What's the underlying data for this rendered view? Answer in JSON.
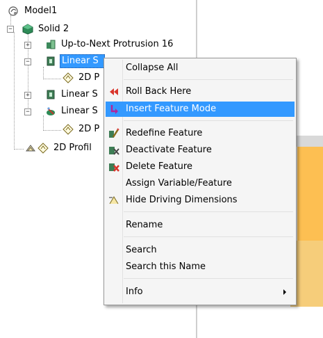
{
  "tree": {
    "model": "Model1",
    "solid": "Solid 2",
    "protrusion": "Up-to-Next Protrusion 16",
    "linear1": "Linear S",
    "profile1": "2D P",
    "linear2": "Linear S",
    "linear3": "Linear S",
    "profile2": "2D P",
    "profile3": "2D Profil"
  },
  "menu": {
    "collapse_all": "Collapse All",
    "roll_back": "Roll Back Here",
    "insert_feature_mode": "Insert Feature Mode",
    "redefine_feature": "Redefine Feature",
    "deactivate_feature": "Deactivate Feature",
    "delete_feature": "Delete Feature",
    "assign_variable": "Assign Variable/Feature",
    "hide_driving_dimensions": "Hide Driving Dimensions",
    "rename": "Rename",
    "search": "Search",
    "search_this_name": "Search this Name",
    "info": "Info"
  },
  "colors": {
    "selection": "#3399ff",
    "menu_bg": "#f5f5f5",
    "solid_green": "#2e8b57",
    "viewport_shape": "#fdbf52"
  }
}
